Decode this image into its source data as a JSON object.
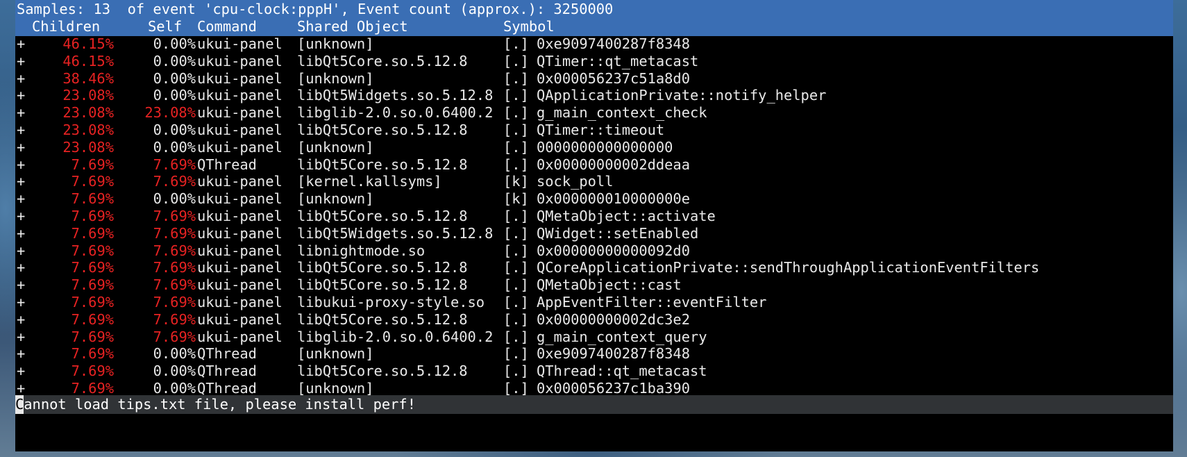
{
  "summary": "Samples: 13  of event 'cpu-clock:pppH', Event count (approx.): 3250000",
  "columns": {
    "children": "Children",
    "self": "Self",
    "command": "Command",
    "shared_object": "Shared Object",
    "symbol": "Symbol"
  },
  "rows": [
    {
      "expand": "+",
      "children": "46.15%",
      "self": "0.00%",
      "command": "ukui-panel",
      "object": "[unknown]",
      "level": "[.]",
      "symbol": "0xe9097400287f8348"
    },
    {
      "expand": "+",
      "children": "46.15%",
      "self": "0.00%",
      "command": "ukui-panel",
      "object": "libQt5Core.so.5.12.8",
      "level": "[.]",
      "symbol": "QTimer::qt_metacast"
    },
    {
      "expand": "+",
      "children": "38.46%",
      "self": "0.00%",
      "command": "ukui-panel",
      "object": "[unknown]",
      "level": "[.]",
      "symbol": "0x000056237c51a8d0"
    },
    {
      "expand": "+",
      "children": "23.08%",
      "self": "0.00%",
      "command": "ukui-panel",
      "object": "libQt5Widgets.so.5.12.8",
      "level": "[.]",
      "symbol": "QApplicationPrivate::notify_helper"
    },
    {
      "expand": "+",
      "children": "23.08%",
      "self": "23.08%",
      "command": "ukui-panel",
      "object": "libglib-2.0.so.0.6400.2",
      "level": "[.]",
      "symbol": "g_main_context_check"
    },
    {
      "expand": "+",
      "children": "23.08%",
      "self": "0.00%",
      "command": "ukui-panel",
      "object": "libQt5Core.so.5.12.8",
      "level": "[.]",
      "symbol": "QTimer::timeout"
    },
    {
      "expand": "+",
      "children": "23.08%",
      "self": "0.00%",
      "command": "ukui-panel",
      "object": "[unknown]",
      "level": "[.]",
      "symbol": "0000000000000000"
    },
    {
      "expand": "+",
      "children": "7.69%",
      "self": "7.69%",
      "command": "QThread",
      "object": "libQt5Core.so.5.12.8",
      "level": "[.]",
      "symbol": "0x00000000002ddeaa"
    },
    {
      "expand": "+",
      "children": "7.69%",
      "self": "7.69%",
      "command": "ukui-panel",
      "object": "[kernel.kallsyms]",
      "level": "[k]",
      "symbol": "sock_poll"
    },
    {
      "expand": "+",
      "children": "7.69%",
      "self": "0.00%",
      "command": "ukui-panel",
      "object": "[unknown]",
      "level": "[k]",
      "symbol": "0x000000010000000e"
    },
    {
      "expand": "+",
      "children": "7.69%",
      "self": "7.69%",
      "command": "ukui-panel",
      "object": "libQt5Core.so.5.12.8",
      "level": "[.]",
      "symbol": "QMetaObject::activate"
    },
    {
      "expand": "+",
      "children": "7.69%",
      "self": "7.69%",
      "command": "ukui-panel",
      "object": "libQt5Widgets.so.5.12.8",
      "level": "[.]",
      "symbol": "QWidget::setEnabled"
    },
    {
      "expand": "+",
      "children": "7.69%",
      "self": "7.69%",
      "command": "ukui-panel",
      "object": "libnightmode.so",
      "level": "[.]",
      "symbol": "0x00000000000092d0"
    },
    {
      "expand": "+",
      "children": "7.69%",
      "self": "7.69%",
      "command": "ukui-panel",
      "object": "libQt5Core.so.5.12.8",
      "level": "[.]",
      "symbol": "QCoreApplicationPrivate::sendThroughApplicationEventFilters"
    },
    {
      "expand": "+",
      "children": "7.69%",
      "self": "7.69%",
      "command": "ukui-panel",
      "object": "libQt5Core.so.5.12.8",
      "level": "[.]",
      "symbol": "QMetaObject::cast"
    },
    {
      "expand": "+",
      "children": "7.69%",
      "self": "7.69%",
      "command": "ukui-panel",
      "object": "libukui-proxy-style.so",
      "level": "[.]",
      "symbol": "AppEventFilter::eventFilter"
    },
    {
      "expand": "+",
      "children": "7.69%",
      "self": "7.69%",
      "command": "ukui-panel",
      "object": "libQt5Core.so.5.12.8",
      "level": "[.]",
      "symbol": "0x00000000002dc3e2"
    },
    {
      "expand": "+",
      "children": "7.69%",
      "self": "7.69%",
      "command": "ukui-panel",
      "object": "libglib-2.0.so.0.6400.2",
      "level": "[.]",
      "symbol": "g_main_context_query"
    },
    {
      "expand": "+",
      "children": "7.69%",
      "self": "0.00%",
      "command": "QThread",
      "object": "[unknown]",
      "level": "[.]",
      "symbol": "0xe9097400287f8348"
    },
    {
      "expand": "+",
      "children": "7.69%",
      "self": "0.00%",
      "command": "QThread",
      "object": "libQt5Core.so.5.12.8",
      "level": "[.]",
      "symbol": "QThread::qt_metacast"
    },
    {
      "expand": "+",
      "children": "7.69%",
      "self": "0.00%",
      "command": "QThread",
      "object": "[unknown]",
      "level": "[.]",
      "symbol": "0x000056237c1ba390"
    }
  ],
  "status": {
    "cursor_char": "C",
    "message": "annot load tips.txt file, please install perf!"
  },
  "colors": {
    "header_bg": "#3a6eb4",
    "hot_value": "#e62222",
    "status_bg": "#303336"
  }
}
